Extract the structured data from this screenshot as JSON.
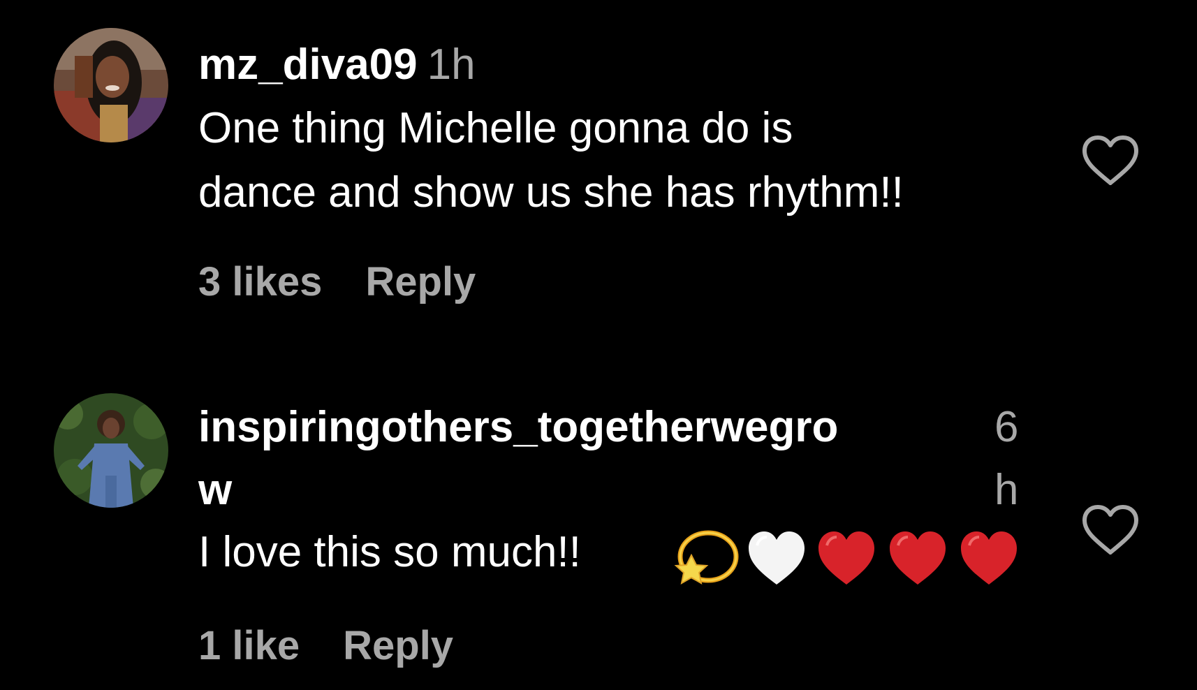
{
  "comments": [
    {
      "username": "mz_diva09",
      "time": "1h",
      "text_lines": [
        "One thing Michelle gonna do is",
        "dance and show us she has rhythm!!"
      ],
      "likes": "3 likes",
      "reply": "Reply"
    },
    {
      "username_lines": [
        "inspiringothers_togetherwegro",
        "w"
      ],
      "time_lines": [
        "6",
        "h"
      ],
      "text": "I love this so much!!",
      "emojis": [
        "dizzy-star",
        "white-heart",
        "red-heart",
        "red-heart",
        "red-heart"
      ],
      "likes": "1 like",
      "reply": "Reply"
    }
  ],
  "colors": {
    "background": "#000000",
    "primary_text": "#ffffff",
    "secondary_text": "#a8a8a8",
    "heart_red": "#d8232a"
  },
  "icons": {
    "like_button": "heart-outline-icon"
  }
}
